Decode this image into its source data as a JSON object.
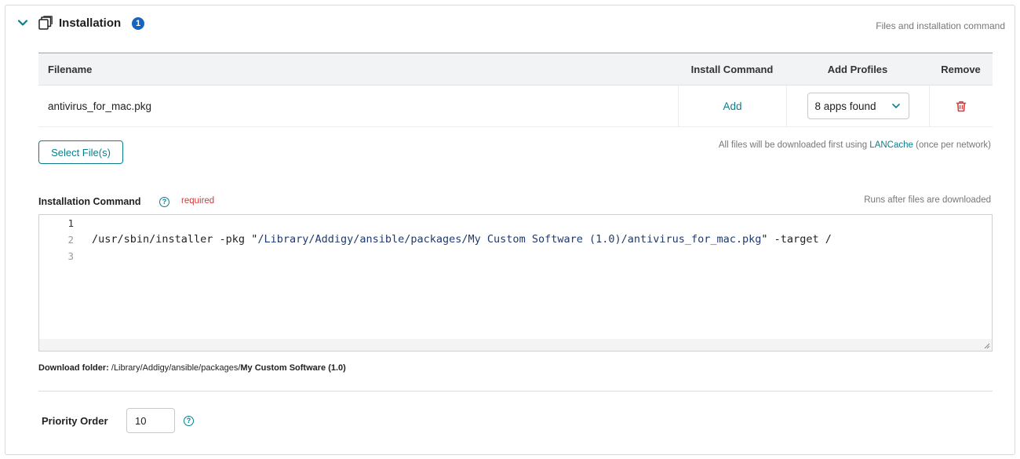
{
  "section": {
    "title": "Installation",
    "badge_count": "1",
    "subtitle": "Files and installation command"
  },
  "table": {
    "headers": {
      "filename": "Filename",
      "install_command": "Install Command",
      "add_profiles": "Add Profiles",
      "remove": "Remove"
    },
    "rows": [
      {
        "filename": "antivirus_for_mac.pkg",
        "install_command_link": "Add",
        "profiles_select": "8 apps found"
      }
    ]
  },
  "select_files_button": "Select File(s)",
  "lancache_note": {
    "prefix": "All files will be downloaded first using ",
    "link": "LANCache",
    "suffix": " (once per network)"
  },
  "install_command": {
    "label": "Installation Command",
    "required": "required",
    "runs_note": "Runs after files are downloaded",
    "line_numbers": [
      "1",
      "2",
      "3"
    ],
    "lines": [
      {
        "plain_before": "",
        "string": "",
        "plain_after": ""
      },
      {
        "plain_before": "/usr/sbin/installer -pkg \"",
        "string": "/Library/Addigy/ansible/packages/My Custom Software (1.0)/antivirus_for_mac.pkg",
        "plain_after": "\" -target /"
      },
      {
        "plain_before": "",
        "string": "",
        "plain_after": ""
      }
    ]
  },
  "download_folder": {
    "label": "Download folder:",
    "path": " /Library/Addigy/ansible/packages/",
    "name": "My Custom Software (1.0)"
  },
  "priority": {
    "label": "Priority Order",
    "value": "10"
  },
  "colors": {
    "accent": "#0a7e8c",
    "badge": "#1565c0",
    "danger": "#d23b3b"
  },
  "icons": [
    "chevron-down-icon",
    "stack-icon",
    "help-icon",
    "trash-icon",
    "resize-grip-icon"
  ]
}
